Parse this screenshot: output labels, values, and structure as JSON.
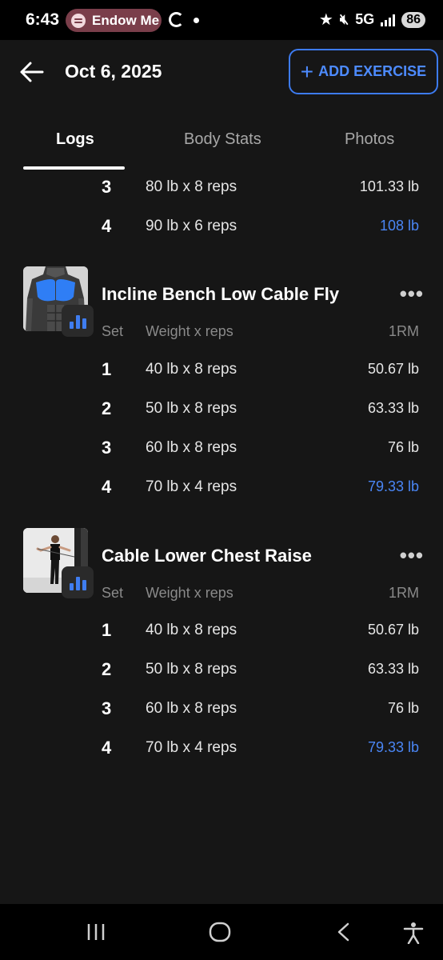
{
  "status_bar": {
    "time": "6:43",
    "media_app": "Endow Me",
    "network": "5G",
    "battery": "86"
  },
  "header": {
    "title": "Oct 6, 2025",
    "add_button_label": "ADD EXERCISE"
  },
  "tabs": [
    {
      "label": "Logs",
      "active": true
    },
    {
      "label": "Body Stats",
      "active": false
    },
    {
      "label": "Photos",
      "active": false
    }
  ],
  "previous_exercise": {
    "sets": [
      {
        "set": "3",
        "reps": "80 lb x 8 reps",
        "orm": "101.33 lb",
        "pr": false
      },
      {
        "set": "4",
        "reps": "90 lb x 6 reps",
        "orm": "108 lb",
        "pr": true
      }
    ]
  },
  "exercises": [
    {
      "name": "Incline Bench Low Cable Fly",
      "thumb_icon": "chest-muscle-diagram-icon",
      "columns": {
        "set": "Set",
        "reps": "Weight x reps",
        "orm": "1RM"
      },
      "sets": [
        {
          "set": "1",
          "reps": "40 lb x 8 reps",
          "orm": "50.67 lb",
          "pr": false
        },
        {
          "set": "2",
          "reps": "50 lb x 8 reps",
          "orm": "63.33 lb",
          "pr": false
        },
        {
          "set": "3",
          "reps": "60 lb x 8 reps",
          "orm": "76 lb",
          "pr": false
        },
        {
          "set": "4",
          "reps": "70 lb x 4 reps",
          "orm": "79.33 lb",
          "pr": true
        }
      ]
    },
    {
      "name": "Cable Lower Chest Raise",
      "thumb_icon": "exercise-photo-icon",
      "columns": {
        "set": "Set",
        "reps": "Weight x reps",
        "orm": "1RM"
      },
      "sets": [
        {
          "set": "1",
          "reps": "40 lb x 8 reps",
          "orm": "50.67 lb",
          "pr": false
        },
        {
          "set": "2",
          "reps": "50 lb x 8 reps",
          "orm": "63.33 lb",
          "pr": false
        },
        {
          "set": "3",
          "reps": "60 lb x 8 reps",
          "orm": "76 lb",
          "pr": false
        },
        {
          "set": "4",
          "reps": "70 lb x 4 reps",
          "orm": "79.33 lb",
          "pr": true
        }
      ]
    }
  ],
  "colors": {
    "background": "#161616",
    "accent": "#4a86f5",
    "text": "#ffffff",
    "muted": "#8a8a8a"
  },
  "nav_icons": [
    "recent-apps-icon",
    "home-icon",
    "back-icon",
    "accessibility-icon"
  ]
}
